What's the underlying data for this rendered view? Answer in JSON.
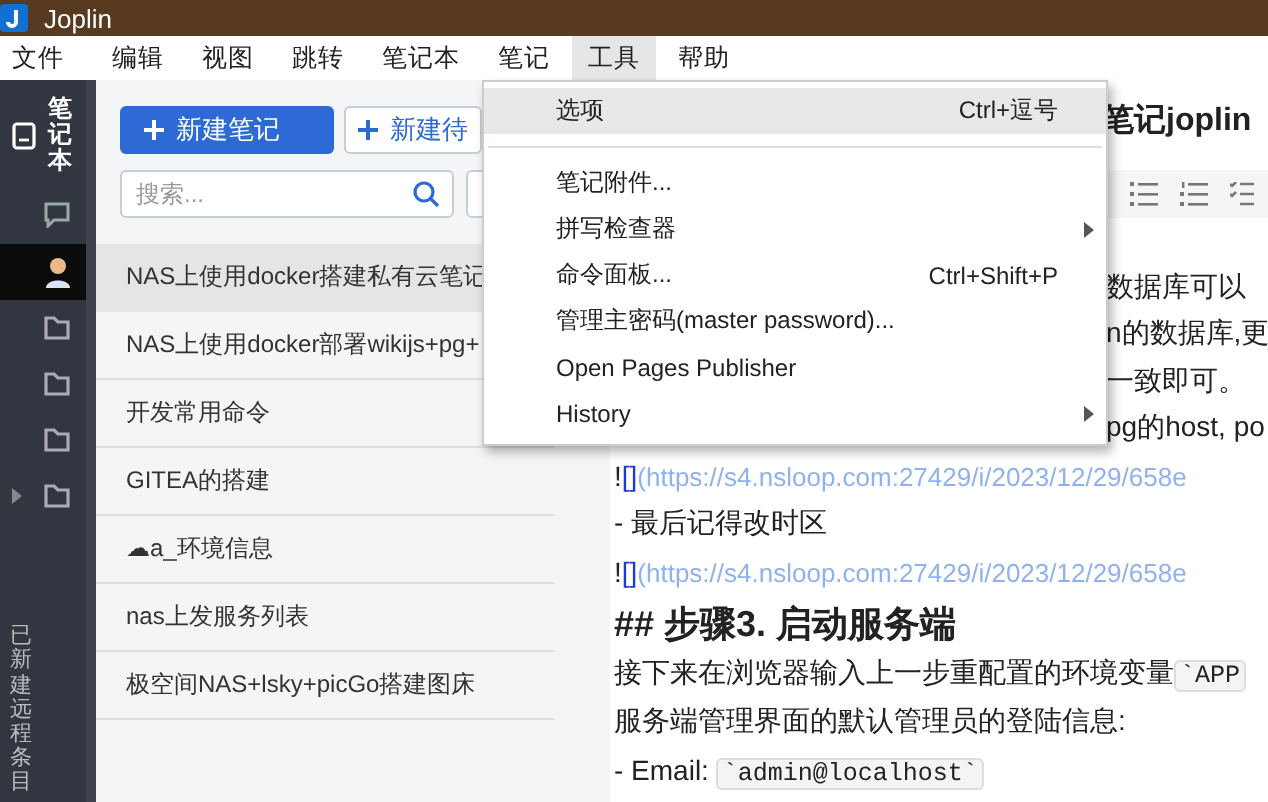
{
  "window": {
    "title": "Joplin"
  },
  "menu_bar": [
    {
      "label": "文件",
      "selected": false
    },
    {
      "label": "编辑",
      "selected": false
    },
    {
      "label": "视图",
      "selected": false
    },
    {
      "label": "跳转",
      "selected": false
    },
    {
      "label": "笔记本",
      "selected": false
    },
    {
      "label": "笔记",
      "selected": false
    },
    {
      "label": "工具",
      "selected": true
    },
    {
      "label": "帮助",
      "selected": false
    }
  ],
  "sidebar": {
    "header": "笔记本",
    "items": [
      {
        "kind": "note-icon",
        "selected": false,
        "expandable": false
      },
      {
        "kind": "avatar",
        "selected": true,
        "expandable": false
      },
      {
        "kind": "folder",
        "selected": false,
        "expandable": false
      },
      {
        "kind": "folder",
        "selected": false,
        "expandable": false
      },
      {
        "kind": "folder",
        "selected": false,
        "expandable": false
      },
      {
        "kind": "folder",
        "selected": false,
        "expandable": true
      }
    ],
    "status": "已新建远程条目"
  },
  "note_list": {
    "new_note_button": "新建笔记",
    "new_todo_button": "新建待",
    "search": {
      "placeholder": "搜索..."
    },
    "notes": [
      {
        "title": "NAS上使用docker搭建私有云笔记",
        "selected": true
      },
      {
        "title": "NAS上使用docker部署wikijs+pg+",
        "selected": false
      },
      {
        "title": "开发常用命令",
        "selected": false
      },
      {
        "title": "GITEA的搭建",
        "selected": false
      },
      {
        "title": "☁a_环境信息",
        "selected": false
      },
      {
        "title": "nas上发服务列表",
        "selected": false
      },
      {
        "title": "极空间NAS+lsky+picGo搭建图床",
        "selected": false
      }
    ]
  },
  "editor": {
    "title": "笔记joplin",
    "partial_lines": [
      "数据库可以",
      "n的数据库,更",
      "一致即可。",
      "pg的host, po"
    ],
    "lines": [
      {
        "kind": "paragraph",
        "parts": [
          {
            "kind": "text",
            "text": "!"
          },
          {
            "kind": "bracket",
            "text": "[]"
          },
          {
            "kind": "url",
            "text": "(https://s4.nsloop.com:27429/i/2023/12/29/658e"
          }
        ]
      },
      {
        "kind": "paragraph",
        "parts": [
          {
            "kind": "text",
            "text": "- 最后记得改时区"
          }
        ]
      },
      {
        "kind": "paragraph",
        "parts": [
          {
            "kind": "text",
            "text": "!"
          },
          {
            "kind": "bracket",
            "text": "[]"
          },
          {
            "kind": "url",
            "text": "(https://s4.nsloop.com:27429/i/2023/12/29/658e"
          }
        ]
      },
      {
        "kind": "heading",
        "parts": [
          {
            "kind": "text",
            "text": "## 步骤3. 启动服务端"
          }
        ]
      },
      {
        "kind": "paragraph",
        "parts": [
          {
            "kind": "text",
            "text": "接下来在浏览器输入上一步重配置的环境变量"
          },
          {
            "kind": "code",
            "text": "`APP"
          }
        ]
      },
      {
        "kind": "paragraph",
        "parts": [
          {
            "kind": "text",
            "text": "服务端管理界面的默认管理员的登陆信息:"
          }
        ]
      },
      {
        "kind": "paragraph",
        "parts": [
          {
            "kind": "text",
            "text": "- Email: "
          },
          {
            "kind": "code",
            "text": "`admin@localhost`"
          }
        ]
      }
    ]
  },
  "dropdown_menu": [
    {
      "kind": "item",
      "label": "选项",
      "shortcut": "Ctrl+逗号",
      "selected": true,
      "submenu": false
    },
    {
      "kind": "separator"
    },
    {
      "kind": "item",
      "label": "笔记附件...",
      "selected": false,
      "submenu": false
    },
    {
      "kind": "item",
      "label": "拼写检查器",
      "selected": false,
      "submenu": true
    },
    {
      "kind": "item",
      "label": "命令面板...",
      "shortcut": "Ctrl+Shift+P",
      "selected": false,
      "submenu": false
    },
    {
      "kind": "item",
      "label": "管理主密码(master password)...",
      "selected": false,
      "submenu": false
    },
    {
      "kind": "item",
      "label": "Open Pages Publisher",
      "selected": false,
      "submenu": false
    },
    {
      "kind": "item",
      "label": "History",
      "selected": false,
      "submenu": true
    }
  ]
}
